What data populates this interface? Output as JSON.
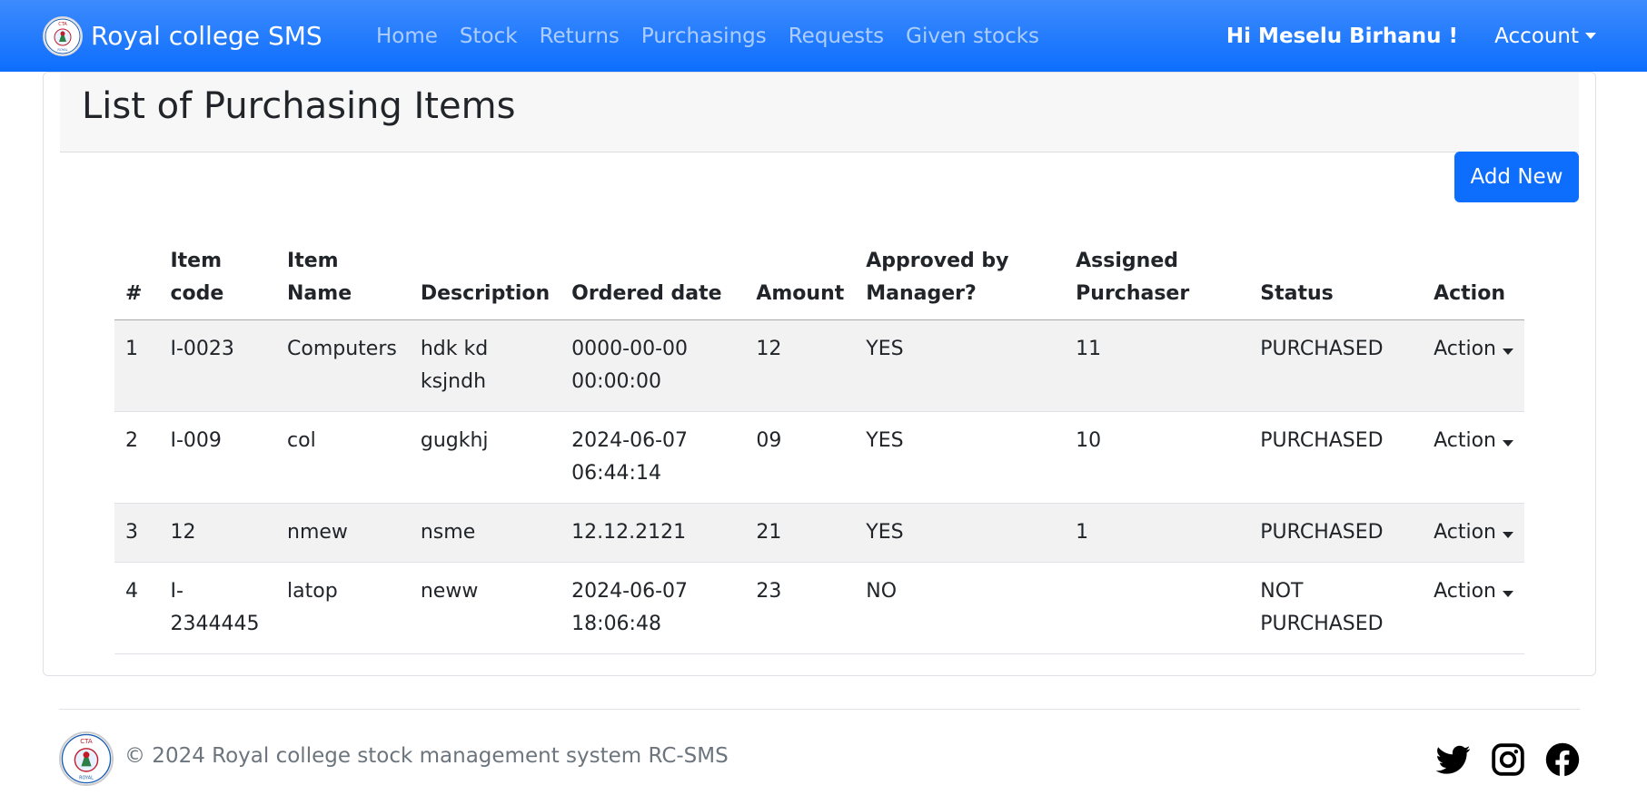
{
  "navbar": {
    "brand": "Royal college SMS",
    "links": [
      "Home",
      "Stock",
      "Returns",
      "Purchasings",
      "Requests",
      "Given stocks"
    ],
    "greeting": "Hi Meselu Birhanu !",
    "account": "Account"
  },
  "card": {
    "title": "List of Purchasing Items",
    "add_button": "Add New"
  },
  "table": {
    "headers": {
      "num": "#",
      "code": "Item code",
      "name": "Item Name",
      "description": "Description",
      "ordered": "Ordered date",
      "amount": "Amount",
      "approved": "Approved by Manager?",
      "purchaser": "Assigned Purchaser",
      "status": "Status",
      "action": "Action"
    },
    "rows": [
      {
        "num": "1",
        "code": "I-0023",
        "name": "Computers",
        "description": "hdk kd ksjndh",
        "ordered": "0000-00-00 00:00:00",
        "amount": "12",
        "approved": "YES",
        "purchaser": "11",
        "status": "PURCHASED",
        "action": "Action"
      },
      {
        "num": "2",
        "code": "I-009",
        "name": "col",
        "description": "gugkhj",
        "ordered": "2024-06-07 06:44:14",
        "amount": "09",
        "approved": "YES",
        "purchaser": "10",
        "status": "PURCHASED",
        "action": "Action"
      },
      {
        "num": "3",
        "code": "12",
        "name": "nmew",
        "description": "nsme",
        "ordered": "12.12.2121",
        "amount": "21",
        "approved": "YES",
        "purchaser": "1",
        "status": "PURCHASED",
        "action": "Action"
      },
      {
        "num": "4",
        "code": "I-2344445",
        "name": "latop",
        "description": "neww",
        "ordered": "2024-06-07 18:06:48",
        "amount": "23",
        "approved": "NO",
        "purchaser": "",
        "status": "NOT PURCHASED",
        "action": "Action"
      }
    ]
  },
  "footer": {
    "text": "© 2024 Royal college stock management system RC-SMS",
    "logo_text": "CTA DAR",
    "logo_subtext": "ROYAL COLLEGE",
    "social": [
      "twitter-icon",
      "instagram-icon",
      "facebook-icon"
    ]
  },
  "colors": {
    "primary": "#0d6efd",
    "stripe": "#f2f2f2"
  }
}
